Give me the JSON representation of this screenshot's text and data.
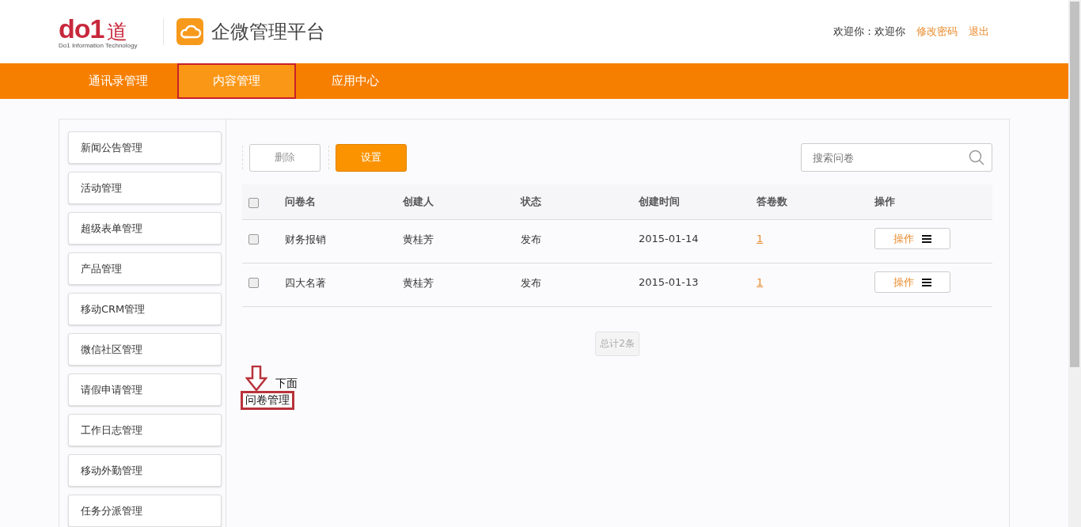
{
  "header": {
    "logo": {
      "mark": "do1",
      "char": "道",
      "tagline": "Do1 Information Technology"
    },
    "app_title": "企微管理平台",
    "welcome": "欢迎你：欢迎你",
    "links": [
      "修改密码",
      "退出"
    ]
  },
  "nav": [
    {
      "label": "通讯录管理",
      "selected": false,
      "annotated": false
    },
    {
      "label": "内容管理",
      "selected": true,
      "annotated": true
    },
    {
      "label": "应用中心",
      "selected": false,
      "annotated": false
    }
  ],
  "sidebar": {
    "items": [
      "新闻公告管理",
      "活动管理",
      "超级表单管理",
      "产品管理",
      "移动CRM管理",
      "微信社区管理",
      "请假申请管理",
      "工作日志管理",
      "移动外勤管理",
      "任务分派管理"
    ]
  },
  "toolbar": {
    "buttons": [
      {
        "label": "删除",
        "kind": "plain"
      },
      {
        "label": "设置",
        "kind": "primary"
      }
    ],
    "search": {
      "placeholder": "搜索问卷"
    }
  },
  "table": {
    "columns": [
      "问卷名",
      "创建人",
      "状态",
      "创建时间",
      "答卷数",
      "操作"
    ],
    "header_checked": false,
    "rows": [
      {
        "checked": false,
        "cells": [
          "财务报销",
          "黄桂芳",
          "发布",
          "2015-01-14"
        ],
        "answers": "1",
        "action": "操作"
      },
      {
        "checked": false,
        "cells": [
          "四大名著",
          "黄桂芳",
          "发布",
          "2015-01-13"
        ],
        "answers": "1",
        "action": "操作"
      }
    ]
  },
  "pagination": {
    "total": "总计2条"
  },
  "annotation": {
    "arrow_text": "下面",
    "boxed_text": "问卷管理"
  }
}
